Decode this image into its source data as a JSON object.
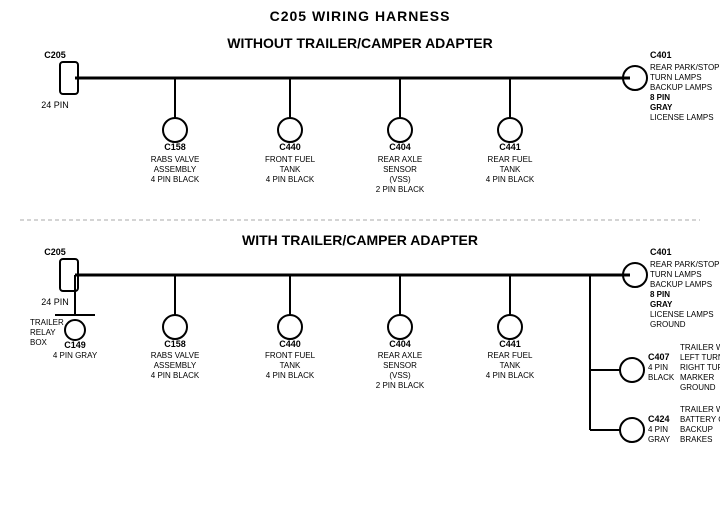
{
  "title": "C205 WIRING HARNESS",
  "section1": {
    "label": "WITHOUT TRAILER/CAMPER ADAPTER",
    "left_connector": {
      "id": "C205",
      "pins": "24 PIN"
    },
    "right_connector": {
      "id": "C401",
      "pins": "8 PIN",
      "color": "GRAY",
      "desc": "REAR PARK/STOP\nTURN LAMPS\nBACKUP LAMPS\nLICENSE LAMPS"
    },
    "connectors": [
      {
        "id": "C158",
        "desc": "RABS VALVE\nASSEMBLY\n4 PIN BLACK"
      },
      {
        "id": "C440",
        "desc": "FRONT FUEL\nTANK\n4 PIN BLACK"
      },
      {
        "id": "C404",
        "desc": "REAR AXLE\nSENSOR\n(VSS)\n2 PIN BLACK"
      },
      {
        "id": "C441",
        "desc": "REAR FUEL\nTANK\n4 PIN BLACK"
      }
    ]
  },
  "section2": {
    "label": "WITH TRAILER/CAMPER ADAPTER",
    "left_connector": {
      "id": "C205",
      "pins": "24 PIN"
    },
    "right_connector": {
      "id": "C401",
      "pins": "8 PIN",
      "color": "GRAY",
      "desc": "REAR PARK/STOP\nTURN LAMPS\nBACKUP LAMPS\nLICENSE LAMPS\nGROUND"
    },
    "extra_left": {
      "label": "TRAILER\nRELAY\nBOX",
      "id": "C149",
      "pins": "4 PIN GRAY"
    },
    "connectors": [
      {
        "id": "C158",
        "desc": "RABS VALVE\nASSEMBLY\n4 PIN BLACK"
      },
      {
        "id": "C440",
        "desc": "FRONT FUEL\nTANK\n4 PIN BLACK"
      },
      {
        "id": "C404",
        "desc": "REAR AXLE\nSENSOR\n(VSS)\n2 PIN BLACK"
      },
      {
        "id": "C441",
        "desc": "REAR FUEL\nTANK\n4 PIN BLACK"
      }
    ],
    "right_extras": [
      {
        "id": "C407",
        "pins": "4 PIN\nBLACK",
        "desc": "TRAILER WIRES\nLEFT TURN\nRIGHT TURN\nMARKER\nGROUND"
      },
      {
        "id": "C424",
        "pins": "4 PIN\nGRAY",
        "desc": "TRAILER WIRES\nBATTERY CHARGE\nBACKUP\nBRAKES"
      }
    ]
  }
}
